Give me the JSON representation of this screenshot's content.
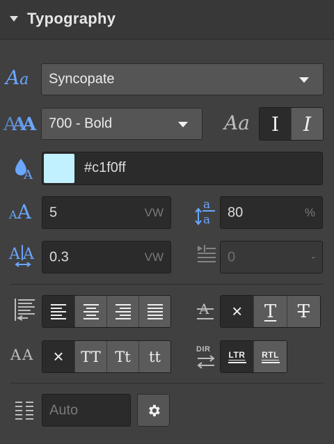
{
  "panel": {
    "title": "Typography"
  },
  "font": {
    "family": "Syncopate"
  },
  "weight": {
    "value": "700 - Bold"
  },
  "style": {
    "normal_glyph": "I",
    "italic_glyph": "I",
    "label_glyph": "Aa"
  },
  "color": {
    "swatch": "#c1f0ff",
    "value": "#c1f0ff"
  },
  "size": {
    "value": "5",
    "unit": "VW"
  },
  "line_height": {
    "value": "80",
    "unit": "%"
  },
  "letter_spacing": {
    "value": "0.3",
    "unit": "VW"
  },
  "text_indent": {
    "value": "0",
    "unit": "-"
  },
  "decoration": {
    "none_glyph": "×",
    "underline_glyph": "T",
    "strike_glyph": "T"
  },
  "transform": {
    "label": "AA",
    "none_glyph": "×",
    "upper": "TT",
    "capitalize": "Tt",
    "lower": "tt"
  },
  "direction": {
    "label": "DIR",
    "ltr": "LTR",
    "rtl": "RTL"
  },
  "columns": {
    "placeholder": "Auto"
  },
  "colors": {
    "accent": "#6aa7ff",
    "panel_bg": "#404040",
    "field_bg": "#2b2b2b",
    "button_bg": "#5b5b5b"
  }
}
